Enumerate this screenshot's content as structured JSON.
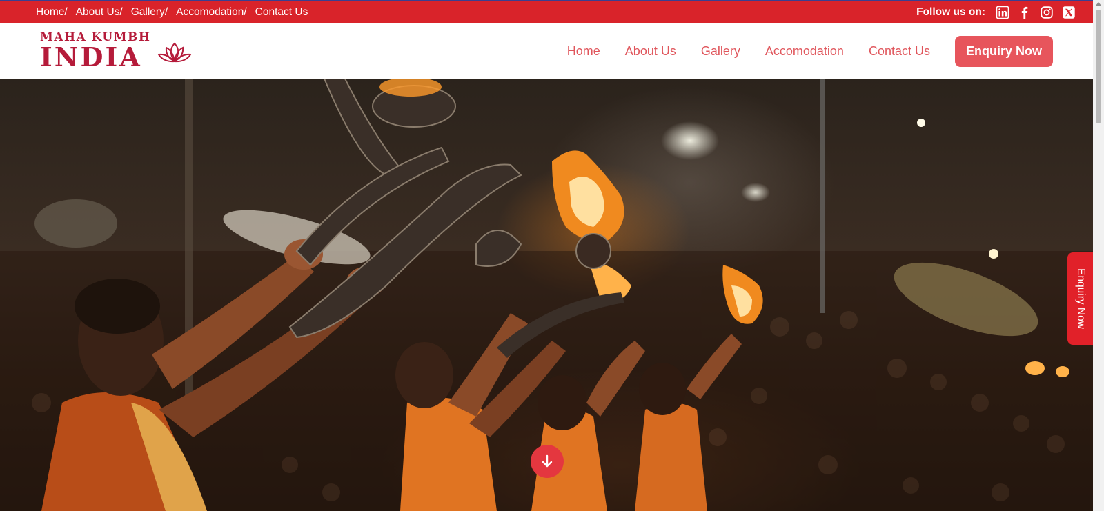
{
  "topbar": {
    "breadcrumbs": [
      "Home/",
      "About Us/",
      "Gallery/",
      "Accomodation/",
      "Contact Us"
    ],
    "follow_label": "Follow us on:",
    "social_icons": [
      "linkedin-icon",
      "facebook-icon",
      "instagram-icon",
      "x-twitter-icon"
    ],
    "background": "#d9232a"
  },
  "header": {
    "logo_line1": "MAHA KUMBH",
    "logo_line2": "INDIA",
    "logo_icon": "lotus-icon",
    "nav": [
      "Home",
      "About Us",
      "Gallery",
      "Accomodation",
      "Contact Us"
    ],
    "cta": "Enquiry Now",
    "brand_color": "#b51b3a",
    "nav_color": "#e0565c"
  },
  "hero": {
    "image": "ganga aarti ceremony with fire lamps at night",
    "scroll_icon": "arrow-down-icon"
  },
  "side_tab": {
    "label": "Enquiry Now",
    "color": "#e12129"
  }
}
